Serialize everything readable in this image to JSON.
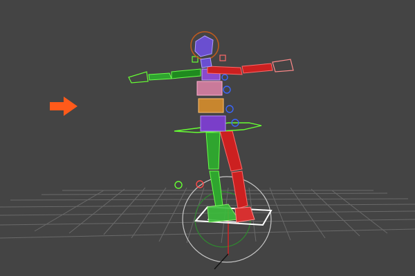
{
  "viewport": {
    "background": "#444444",
    "view": "perspective",
    "grid": true
  },
  "colors": {
    "left_side": "#2fa52f",
    "right_side": "#cc2020",
    "spine_purple": "#7a3ec9",
    "spine_pink": "#c97a9a",
    "spine_orange": "#c8862e",
    "head": "#6a4fd0",
    "head_ring": "#c05a1e",
    "wire_green": "#66ff33",
    "wire_blue": "#3a66ff",
    "floor_ring": "#cccccc",
    "footprint": "#ffffff",
    "arrow": "#ff5a1a",
    "grid": "#6a6a6a"
  },
  "rig": {
    "name": "biped-skeleton",
    "pose": "t-pose",
    "selection_arrow_icon": "arrow-right-icon"
  }
}
